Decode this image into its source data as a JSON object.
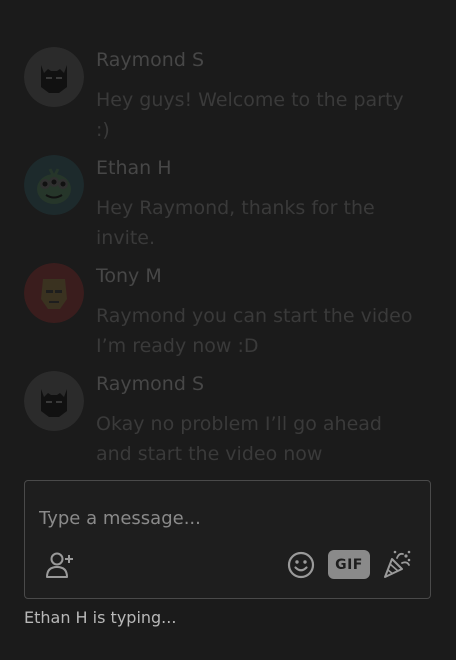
{
  "messages": [
    {
      "name": "Raymond S",
      "text": "Hey guys! Welcome to the party :)",
      "avatar": "batman-icon"
    },
    {
      "name": "Ethan H",
      "text": "Hey Raymond, thanks for the invite.",
      "avatar": "alien-icon"
    },
    {
      "name": "Tony M",
      "text": "Raymond you can start the video I’m ready now :D",
      "avatar": "ironman-icon"
    },
    {
      "name": "Raymond S",
      "text": "Okay no problem I’ll go ahead and start the video now",
      "avatar": "batman-icon"
    }
  ],
  "composer": {
    "placeholder": "Type a message...",
    "gif_label": "GIF"
  },
  "status": {
    "typing": "Ethan H is typing..."
  },
  "colors": {
    "background": "#1b1b1b",
    "muted_text": "#3a3a3a",
    "composer_border": "#4a4a4a",
    "icon_gray": "#8a8a8a"
  }
}
